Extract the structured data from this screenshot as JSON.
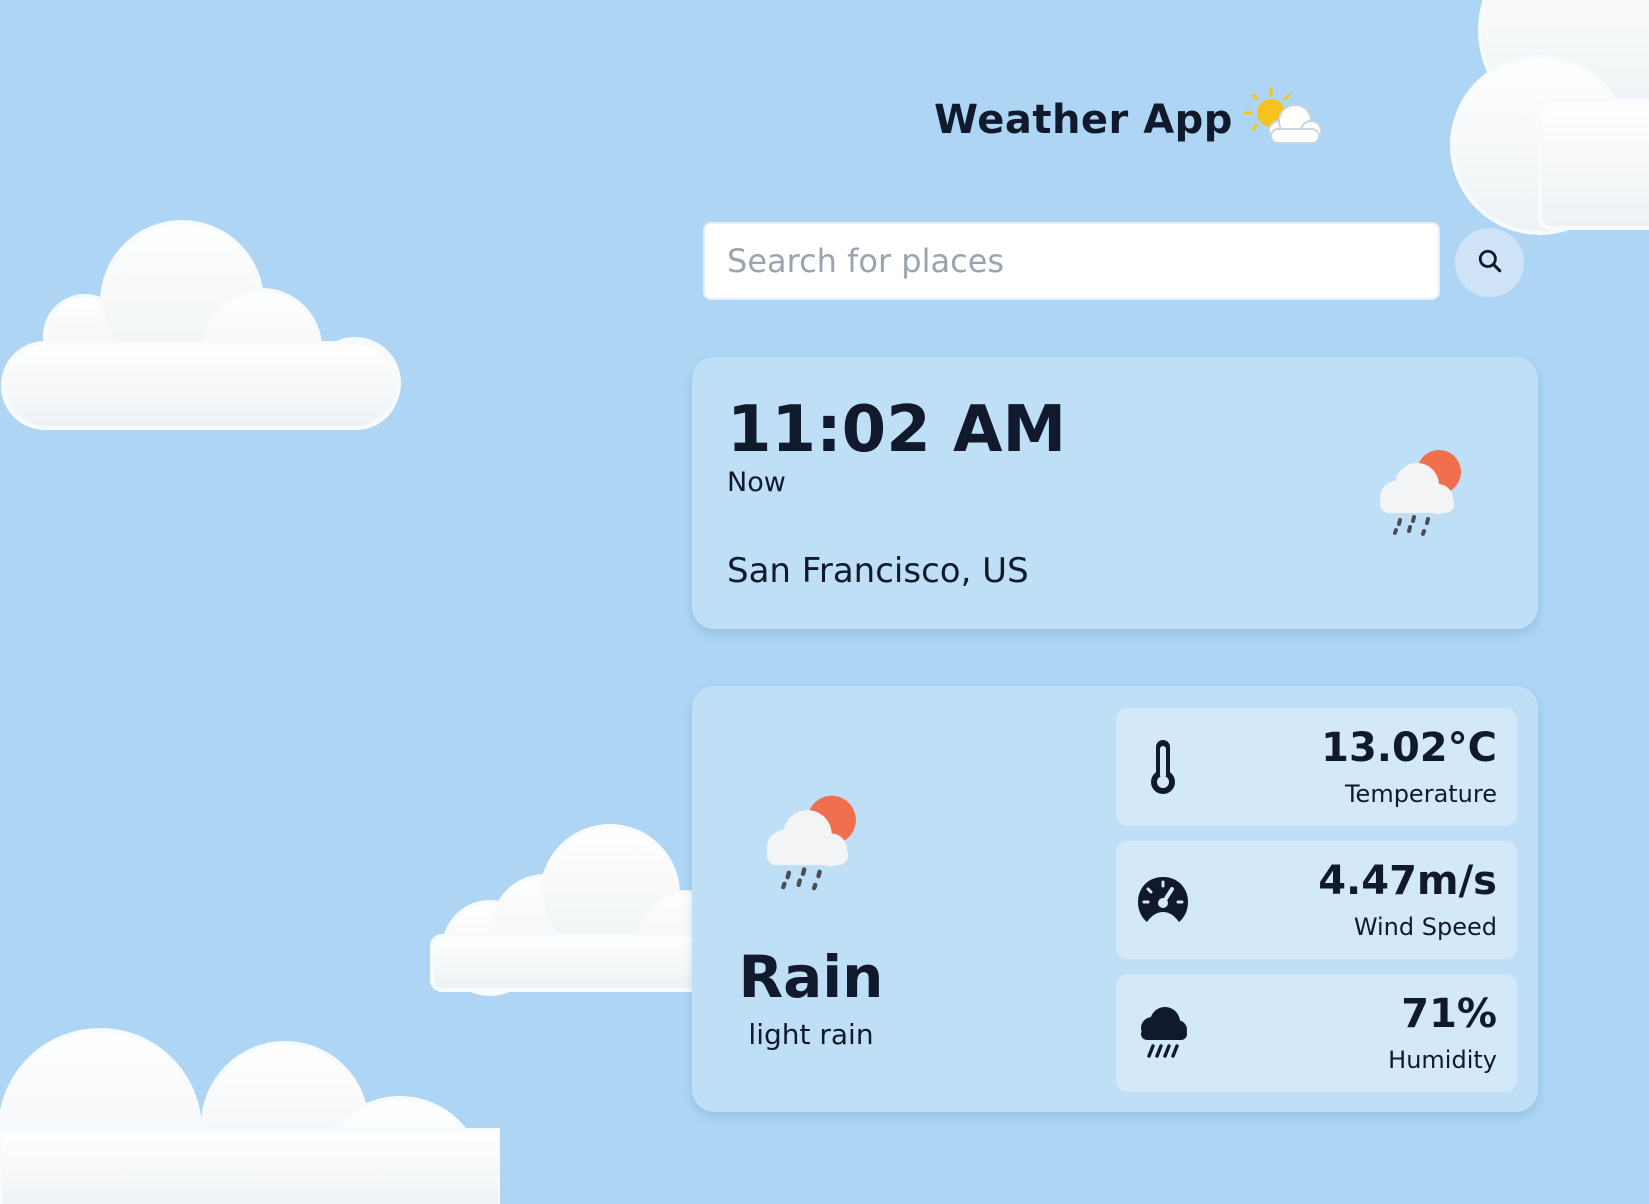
{
  "app": {
    "title": "Weather App"
  },
  "search": {
    "placeholder": "Search for places",
    "value": ""
  },
  "current": {
    "time": "11:02 AM",
    "label": "Now",
    "location": "San Francisco, US"
  },
  "weather": {
    "condition": "Rain",
    "description": "light rain",
    "stats": [
      {
        "value": "13.02°C",
        "label": "Temperature",
        "icon": "thermometer-icon"
      },
      {
        "value": "4.47m/s",
        "label": "Wind Speed",
        "icon": "speedometer-icon"
      },
      {
        "value": "71%",
        "label": "Humidity",
        "icon": "rain-cloud-icon"
      }
    ]
  },
  "colors": {
    "background": "#aed6f4",
    "card": "#bfdff6",
    "stat_card": "#d3e9f9",
    "text": "#111a2c",
    "sun": "#ef6f4f"
  }
}
